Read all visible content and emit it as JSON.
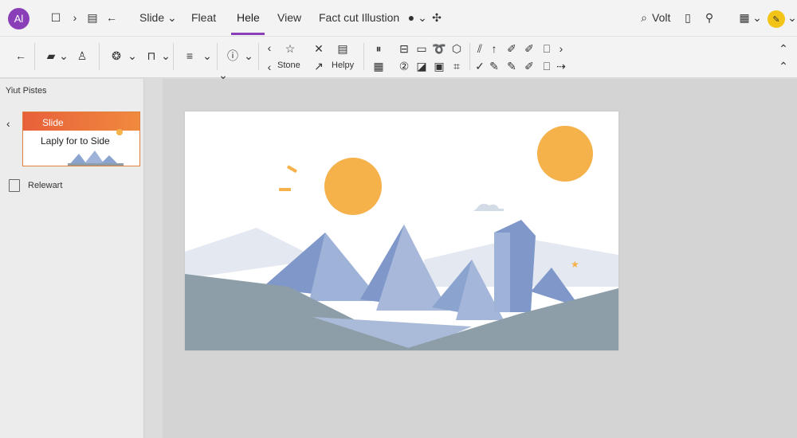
{
  "app": {
    "logo_text": "Al"
  },
  "menu": {
    "items": [
      "Slide",
      "Fleat",
      "Hele",
      "View",
      "Fact cut Illustion"
    ],
    "active_item": "Hele",
    "right_label": "Volt"
  },
  "toolbar": {
    "stone_label": "Stone",
    "help_label": "Helpy"
  },
  "left_panel": {
    "title": "Yiut Pistes",
    "thumbnail": {
      "title": "Slide",
      "subtitle": "Laply for to Side"
    },
    "related_item": "Relewart"
  },
  "colors": {
    "accent": "#8a3fb8",
    "sun": "#f5b14a",
    "mountain": "#8ba3cf",
    "ground": "#8e9ea8"
  }
}
